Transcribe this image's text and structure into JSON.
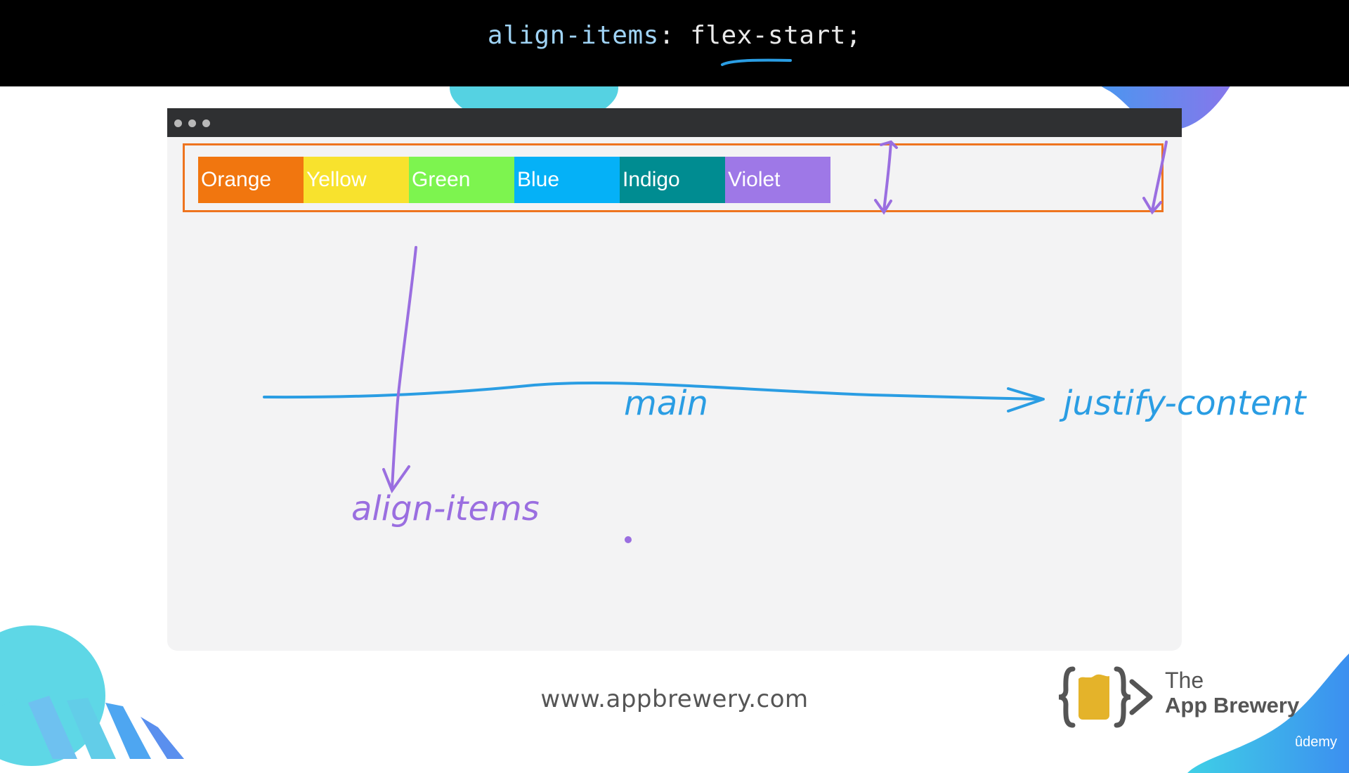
{
  "code": {
    "property": "align-items",
    "colon": ":",
    "value": "flex-start;"
  },
  "flex_items": [
    {
      "label": "Orange",
      "color": "#f1760f"
    },
    {
      "label": "Yellow",
      "color": "#f8e22d"
    },
    {
      "label": "Green",
      "color": "#7df44f"
    },
    {
      "label": "Blue",
      "color": "#05b1f7"
    },
    {
      "label": "Indigo",
      "color": "#008c91"
    },
    {
      "label": "Violet",
      "color": "#9e78e7"
    }
  ],
  "annotations": {
    "main_label": "main",
    "justify_label": "justify-content",
    "align_label": "align-items",
    "color_blue": "#2a9de3",
    "color_purple": "#9a6ee0"
  },
  "footer": {
    "url": "www.appbrewery.com",
    "brand_the": "The",
    "brand_name": "App Brewery",
    "platform": "ûdemy"
  }
}
